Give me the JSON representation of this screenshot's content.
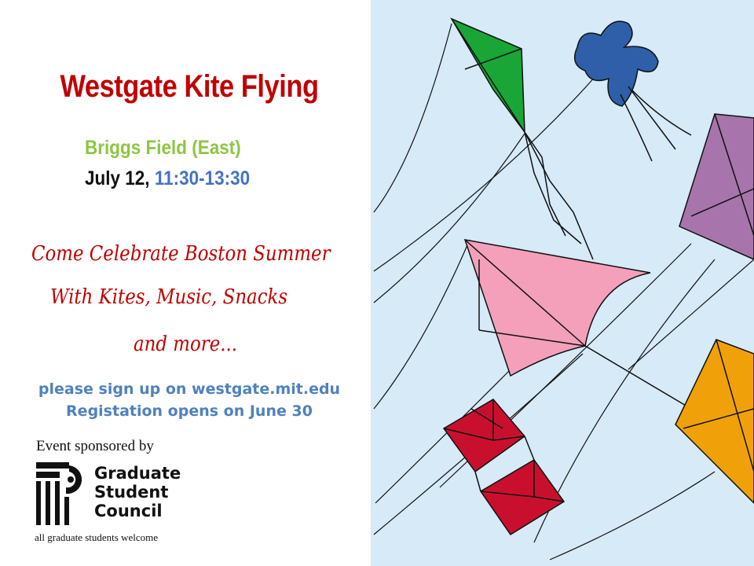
{
  "flyer": {
    "title": "Westgate Kite Flying",
    "location": "Briggs Field (East)",
    "date": "July 12,",
    "time": "11:30-13:30",
    "tagline": [
      "Come Celebrate Boston Summer",
      "With Kites, Music, Snacks",
      "and more..."
    ],
    "signup": "please sign up on westgate.mit.edu",
    "registration": "Registation opens on June 30",
    "sponsor_label": "Event sponsored by",
    "sponsor_name": [
      "Graduate",
      "Student",
      "Council"
    ],
    "welcome": "all graduate students welcome"
  },
  "colors": {
    "title": "#c00000",
    "location": "#8dc641",
    "time": "#4472c4",
    "signup": "#4f81bd",
    "sky": "#d6eaf8",
    "kite_green": "#1aa537",
    "kite_blue": "#2e5fa8",
    "kite_purple": "#a775ab",
    "kite_pink": "#f4a0bb",
    "kite_orange": "#f0a10a",
    "kite_red": "#c8102e"
  },
  "illustration": {
    "subject": "kites-in-sky",
    "kites": [
      "green-diamond-kite",
      "blue-bow-kite",
      "purple-diamond-kite",
      "pink-delta-kite",
      "orange-diamond-kite",
      "red-box-kite"
    ]
  }
}
